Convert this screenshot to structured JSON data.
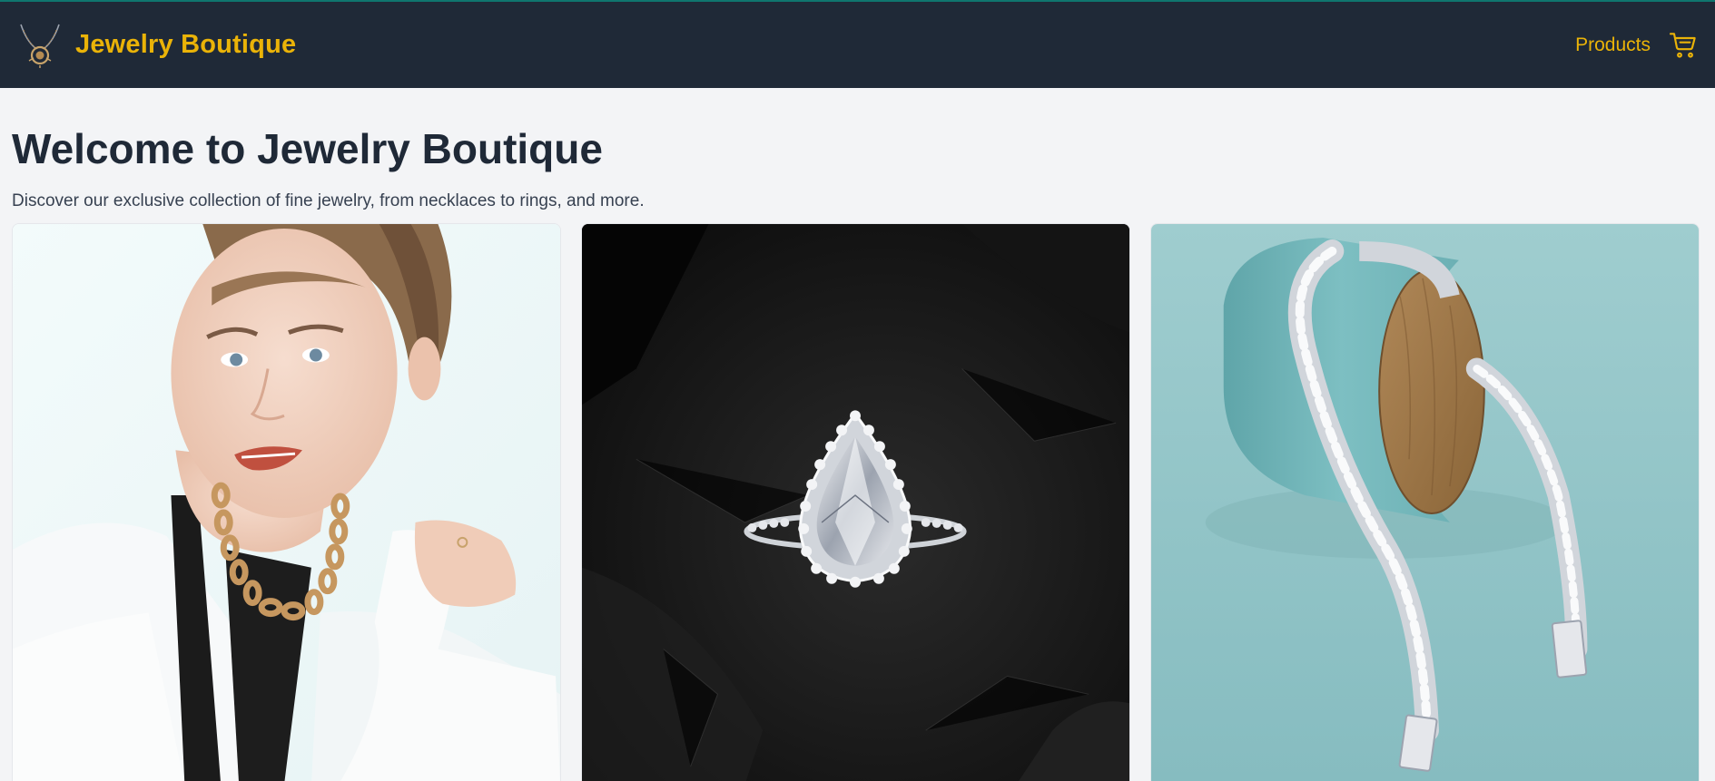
{
  "header": {
    "brand": "Jewelry Boutique",
    "logo_icon": "necklace-pendant-icon",
    "nav": {
      "products_label": "Products"
    },
    "cart_icon": "shopping-cart-icon"
  },
  "hero": {
    "title": "Welcome to Jewelry Boutique",
    "subtitle": "Discover our exclusive collection of fine jewelry, from necklaces to rings, and more."
  },
  "products": [
    {
      "image": "woman-gold-chain-necklace"
    },
    {
      "image": "pear-diamond-halo-ring"
    },
    {
      "image": "silver-cuban-link-chain"
    }
  ],
  "colors": {
    "header_bg": "#1f2937",
    "accent": "#eab308",
    "page_bg": "#f3f4f6",
    "title_text": "#1f2937"
  }
}
